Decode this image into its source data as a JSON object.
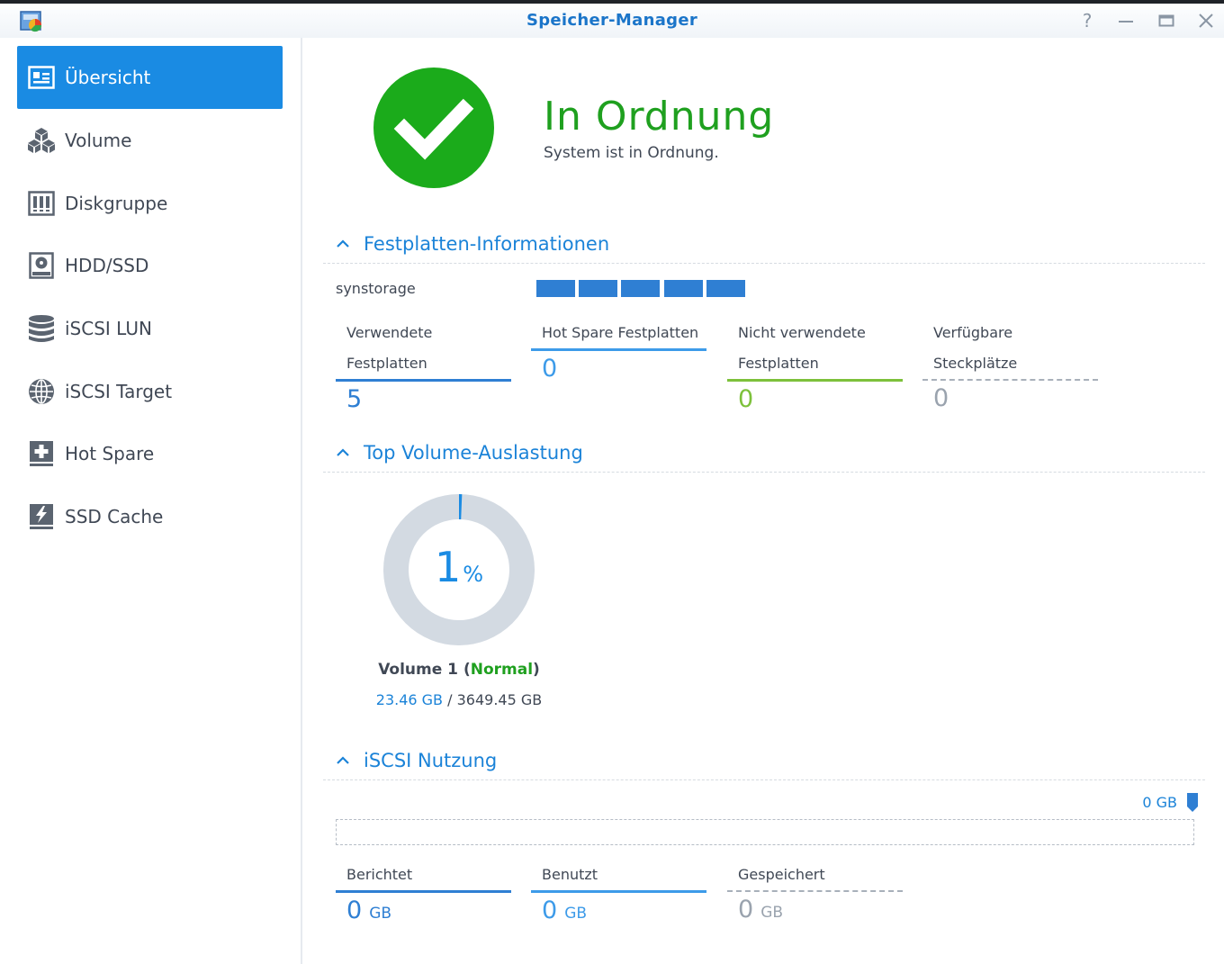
{
  "window": {
    "title": "Speicher-Manager"
  },
  "sidebar": {
    "items": [
      {
        "label": "Übersicht",
        "icon": "overview-icon",
        "active": true
      },
      {
        "label": "Volume",
        "icon": "volume-cubes-icon",
        "active": false
      },
      {
        "label": "Diskgruppe",
        "icon": "diskgroup-icon",
        "active": false
      },
      {
        "label": "HDD/SSD",
        "icon": "hdd-icon",
        "active": false
      },
      {
        "label": "iSCSI LUN",
        "icon": "database-icon",
        "active": false
      },
      {
        "label": "iSCSI Target",
        "icon": "globe-icon",
        "active": false
      },
      {
        "label": "Hot Spare",
        "icon": "hot-spare-plus-icon",
        "active": false
      },
      {
        "label": "SSD Cache",
        "icon": "ssd-cache-bolt-icon",
        "active": false
      }
    ]
  },
  "status": {
    "title": "In Ordnung",
    "subtitle": "System ist in Ordnung.",
    "icon": "checkmark-icon",
    "color": "#1bab1b"
  },
  "disk_info": {
    "section_title": "Festplatten-Informationen",
    "device_name": "synstorage",
    "slot_count": 5,
    "slot_color": "#2f7fd3",
    "stats": [
      {
        "label_line1": "Verwendete",
        "label_line2": "Festplatten",
        "value": "5"
      },
      {
        "label_line1": "Hot Spare Festplatten",
        "label_line2": "",
        "value": "0"
      },
      {
        "label_line1": "Nicht verwendete",
        "label_line2": "Festplatten",
        "value": "0"
      },
      {
        "label_line1": "Verfügbare",
        "label_line2": "Steckplätze",
        "value": "0"
      }
    ]
  },
  "volume_usage": {
    "section_title": "Top Volume-Auslastung",
    "percent": "1",
    "percent_symbol": "%",
    "percent_value": 0.64,
    "volume_label": "Volume 1",
    "volume_status": "Normal",
    "used": "23.46 GB",
    "separator": "/",
    "total": "3649.45 GB"
  },
  "iscsi": {
    "section_title": "iSCSI Nutzung",
    "max_label": "0 GB",
    "stats": [
      {
        "label": "Berichtet",
        "value": "0",
        "unit": "GB"
      },
      {
        "label": "Benutzt",
        "value": "0",
        "unit": "GB"
      },
      {
        "label": "Gespeichert",
        "value": "0",
        "unit": "GB"
      }
    ]
  },
  "colors": {
    "accent": "#1a8be3",
    "ok_green": "#1fa01f",
    "donut_track": "#d3dae2",
    "unused_green": "#7dc13b",
    "text": "#404855"
  }
}
